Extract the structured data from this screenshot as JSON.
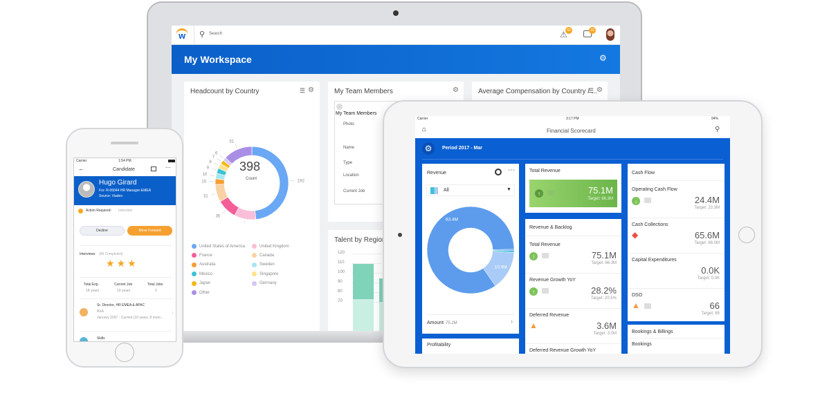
{
  "laptop": {
    "search_placeholder": "Search",
    "notifications_badge": "60",
    "inbox_badge": "33",
    "header_title": "My Workspace",
    "headcount": {
      "title": "Headcount by Country",
      "total": "398",
      "total_label": "Count",
      "slices": [
        {
          "country": "United States of America",
          "value": 192,
          "color": "#6aa8f5"
        },
        {
          "country": "United Kingdom",
          "value": 38,
          "color": "#f9bfd9"
        },
        {
          "country": "France",
          "value": 35,
          "color": "#f45f98"
        },
        {
          "country": "Canada",
          "value": 31,
          "color": "#f9d2a3"
        },
        {
          "country": "Australia",
          "value": 10,
          "color": "#f59e32"
        },
        {
          "country": "Sweden",
          "value": 10,
          "color": "#a8e6f0"
        },
        {
          "country": "Mexico",
          "value": 9,
          "color": "#3cc2d6"
        },
        {
          "country": "Singapore",
          "value": 9,
          "color": "#fde38e"
        },
        {
          "country": "Japan",
          "value": 7,
          "color": "#f6b715"
        },
        {
          "country": "Germany",
          "value": 6,
          "color": "#d6c5f5"
        },
        {
          "country": "Other",
          "value": 51,
          "color": "#a98ee6"
        }
      ],
      "legend": [
        "United States of America",
        "United Kingdom",
        "France",
        "Canada",
        "Australia",
        "Sweden",
        "Mexico",
        "Singapore",
        "Japan",
        "Germany",
        "Other"
      ]
    },
    "team": {
      "title": "My Team Members",
      "inner_title": "My Team Members",
      "fields": [
        "Photo",
        "Name",
        "Type",
        "Location",
        "Current Job"
      ]
    },
    "avg_comp": {
      "title": "Average Compensation by Country / ..."
    },
    "talent": {
      "title": "Talent by Region",
      "ticks": [
        "120",
        "110",
        "100",
        "90",
        "80",
        "70"
      ],
      "bars": [
        {
          "total": 109,
          "lower": 73
        },
        {
          "total": 94,
          "lower": 70
        }
      ]
    }
  },
  "phone": {
    "carrier": "Carrier",
    "time": "1:54 PM",
    "nav_title": "Candidate",
    "name": "Hugo Girard",
    "for": "For: R-00044 HR Manager-EMEA",
    "source": "Source: Viadeo",
    "action_label": "Action Required:",
    "action_value": "Interview",
    "decline": "Decline",
    "move_forward": "Move Forward",
    "interviews": "Interviews",
    "interviews_status": "(All Completed)",
    "stars": 3,
    "stats": [
      {
        "label": "Total Exp.",
        "value": "18 years"
      },
      {
        "label": "Current Job",
        "value": "10 years"
      },
      {
        "label": "Total Jobs",
        "value": "3"
      }
    ],
    "job": {
      "title": "Sr. Director, HR EMEA & APAC",
      "company": "AXA",
      "dates": "January 2007 - Current  (10 years, 8 mont..."
    },
    "skills": "Skills"
  },
  "ipad": {
    "carrier": "Carrier",
    "time": "3:17 PM",
    "battery": "94%",
    "title": "Financial Scorecard",
    "period": "Period 2017 - Mar",
    "revenue": {
      "title": "Revenue",
      "filter": "All",
      "amount_label": "Amount",
      "amount_value": "75.2M",
      "slices": [
        {
          "label": "63.4M",
          "value": 63.4,
          "color": "#5d9cec"
        },
        {
          "label": "10.9M",
          "value": 10.9,
          "color": "#a9cbf7"
        },
        {
          "label": "",
          "value": 0.5,
          "color": "#3cc2d6"
        },
        {
          "label": "",
          "value": 0.4,
          "color": "#6aa8f5"
        }
      ]
    },
    "profitability": "Profitability",
    "total_revenue": {
      "title": "Total Revenue",
      "value": "75.1M",
      "target": "Target: 66.3M"
    },
    "backlog": {
      "title": "Revenue & Backlog",
      "rows": [
        {
          "label": "Total Revenue",
          "value": "75.1M",
          "target": "Target: 66.3M",
          "status": "up"
        },
        {
          "label": "Revenue Growth YoY",
          "value": "28.2%",
          "target": "Target: 20.5%",
          "status": "up"
        },
        {
          "label": "Deferred Revenue",
          "value": "3.6M",
          "target": "Target: 3.0M",
          "status": "warning"
        },
        {
          "label": "Deferred Revenue Growth YoY",
          "value": "",
          "target": "",
          "status": ""
        }
      ]
    },
    "cashflow": {
      "title": "Cash Flow",
      "rows": [
        {
          "label": "Operating Cash Flow",
          "value": "24.4M",
          "target": "Target: 23.3M",
          "status": "down"
        },
        {
          "label": "Cash Collections",
          "value": "65.6M",
          "target": "Target: 68.0M",
          "status": "alert"
        },
        {
          "label": "Capital Expenditures",
          "value": "0.0K",
          "target": "Target: 0.0K",
          "status": ""
        },
        {
          "label": "DSO",
          "value": "66",
          "target": "Target: 65",
          "status": "warning"
        }
      ]
    },
    "bookings": {
      "title": "Bookings & Billings",
      "row": "Bookings"
    }
  },
  "colors": {
    "blue": "#0b66d6",
    "orange": "#f5a623",
    "green": "#7cc35a",
    "red": "#e8504a"
  }
}
